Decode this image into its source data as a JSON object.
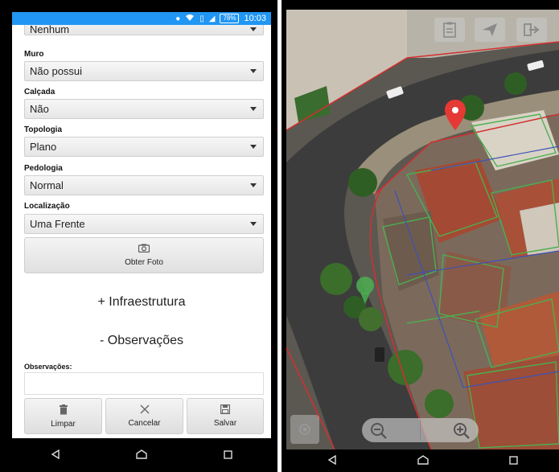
{
  "status_bar": {
    "battery": "78%",
    "time": "10:03"
  },
  "form": {
    "partial_select": "Nenhum",
    "fields": [
      {
        "label": "Muro",
        "value": "Não possui"
      },
      {
        "label": "Calçada",
        "value": "Não"
      },
      {
        "label": "Topologia",
        "value": "Plano"
      },
      {
        "label": "Pedologia",
        "value": "Normal"
      },
      {
        "label": "Localização",
        "value": "Uma Frente"
      }
    ],
    "photo_button": "Obter Foto",
    "sections": {
      "infra": "+ Infraestrutura",
      "obs": "- Observações"
    },
    "obs_label": "Observações:",
    "actions": {
      "clear": "Limpar",
      "cancel": "Cancelar",
      "save": "Salvar"
    }
  },
  "colors": {
    "status_bar": "#2196f3",
    "marker": "#e53935",
    "lot_green": "#4caf50",
    "lot_red": "#d32f2f",
    "lot_blue": "#3f51b5"
  }
}
